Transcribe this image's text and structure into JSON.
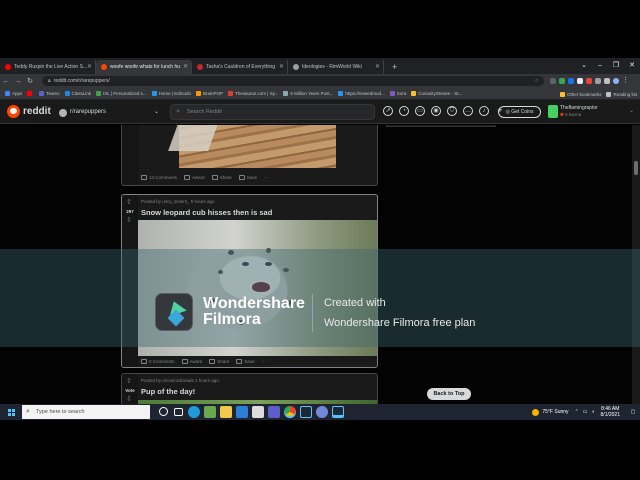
{
  "browser": {
    "tabs": [
      {
        "label": "Teddy Ruxpin the Live Action S...",
        "favicon_color": "#ff0000",
        "active": false
      },
      {
        "label": "woofe woofe whats for lunch hu",
        "favicon_color": "#ff4500",
        "active": true
      },
      {
        "label": "Tasha's Cauldron of Everything",
        "favicon_color": "#c62828",
        "active": false
      },
      {
        "label": "Ideologies - RimWorld Wiki",
        "favicon_color": "#9e9e9e",
        "active": false
      }
    ],
    "new_tab": "+",
    "url": "reddit.com/r/rarepuppers/",
    "bookmarks": [
      {
        "label": "Apps",
        "color": "#4285f4"
      },
      {
        "label": "",
        "color": "#ff0000"
      },
      {
        "label": "Teams",
        "color": "#5b5fc7"
      },
      {
        "label": "ClassLink",
        "color": "#1e88e5"
      },
      {
        "label": "IXL | Personalized s...",
        "color": "#43a047"
      },
      {
        "label": "Home | Edmodo",
        "color": "#2196f3"
      },
      {
        "label": "BrainPOP",
        "color": "#ff9800"
      },
      {
        "label": "Thesaurus.com | Sy...",
        "color": "#e53935"
      },
      {
        "label": "5 Million Years Post...",
        "color": "#90a4ae"
      },
      {
        "label": "https://newedmod...",
        "color": "#2196f3"
      },
      {
        "label": "Sora",
        "color": "#7e57c2"
      },
      {
        "label": "CuriosityStream - St...",
        "color": "#fbc02d"
      }
    ],
    "other_bookmarks": "Other bookmarks",
    "reading_list": "Reading list"
  },
  "reddit": {
    "wordmark": "reddit",
    "community": "r/rarepuppers",
    "search_placeholder": "Search Reddit",
    "get_coins": "Get Coins",
    "username": "Theflamingraptor",
    "karma": "0 karma"
  },
  "posts": [
    {
      "actions": {
        "comments": "14 Comments",
        "award": "Award",
        "share": "Share",
        "save": "Save",
        "more": "···"
      }
    },
    {
      "score": "297",
      "meta": "Posted by u/Icy_Extent_ 5 hours ago",
      "title": "Snow leopard cub hisses then is sad",
      "actions": {
        "comments": "0 Comments",
        "award": "Award",
        "share": "Share",
        "save": "Save",
        "more": "···"
      }
    },
    {
      "score": "Vote",
      "meta": "Posted by u/cosmicbreads 1 hours ago",
      "title": "Pup of the day!"
    }
  ],
  "watermark": {
    "brand_line1": "Wondershare",
    "brand_line2": "Filmora",
    "created": "Created with",
    "plan": "Wondershare Filmora free plan"
  },
  "back_to_top": "Back to Top",
  "taskbar": {
    "search_placeholder": "Type here to search",
    "weather": "75°F  Sunny",
    "time": "8:46 AM",
    "date": "8/1/2021"
  }
}
